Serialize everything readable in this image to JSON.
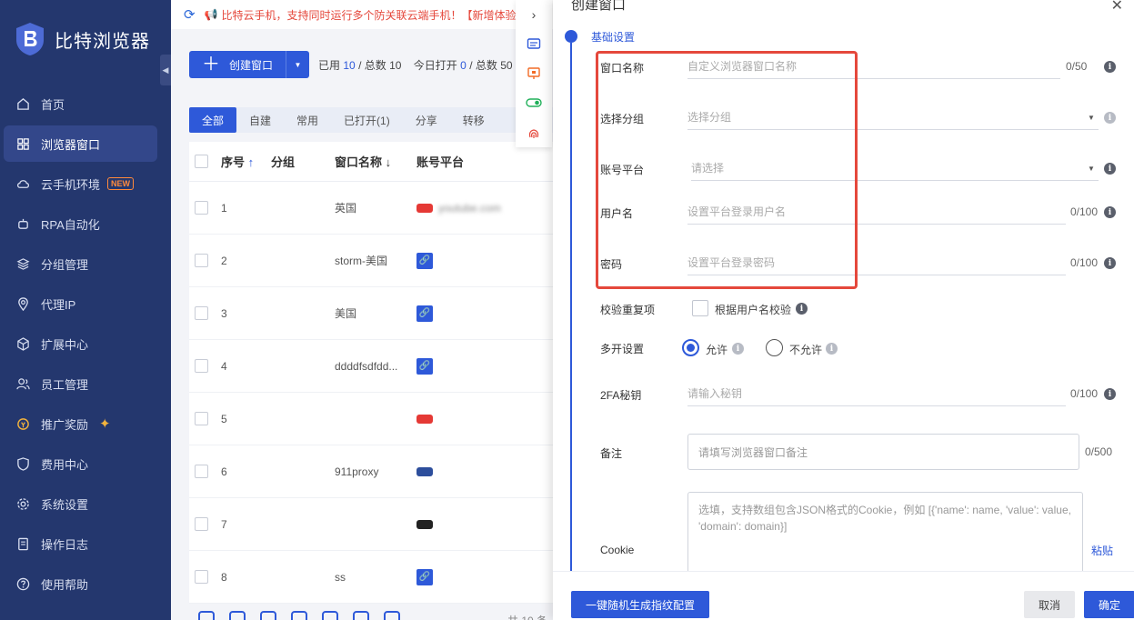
{
  "app": {
    "name": "比特浏览器"
  },
  "sidebar": {
    "items": [
      {
        "label": "首页",
        "icon": "home-icon"
      },
      {
        "label": "浏览器窗口",
        "icon": "grid-icon",
        "active": true
      },
      {
        "label": "云手机环境",
        "icon": "cloud-icon",
        "badge": "NEW"
      },
      {
        "label": "RPA自动化",
        "icon": "robot-icon"
      },
      {
        "label": "分组管理",
        "icon": "layers-icon"
      },
      {
        "label": "代理IP",
        "icon": "location-icon"
      },
      {
        "label": "扩展中心",
        "icon": "cube-icon"
      },
      {
        "label": "员工管理",
        "icon": "users-icon"
      },
      {
        "label": "推广奖励",
        "icon": "coin-icon"
      },
      {
        "label": "费用中心",
        "icon": "shield-icon"
      },
      {
        "label": "系统设置",
        "icon": "gear-icon"
      },
      {
        "label": "操作日志",
        "icon": "log-icon"
      },
      {
        "label": "使用帮助",
        "icon": "help-icon"
      }
    ]
  },
  "notice": {
    "text": "比特云手机，支持同时运行多个防关联云端手机！【新增体验"
  },
  "toolbar": {
    "create_label": "创建窗口",
    "used_prefix": "已用",
    "used": "10",
    "total_prefix": "/ 总数",
    "total": "10",
    "today_prefix": "今日打开",
    "today": "0",
    "today_total_prefix": "/ 总数",
    "today_total": "50"
  },
  "tabs": [
    "全部",
    "自建",
    "常用",
    "已打开(1)",
    "分享",
    "转移"
  ],
  "table": {
    "headers": {
      "seq": "序号",
      "seq_sort": "↑",
      "group": "分组",
      "name": "窗口名称",
      "name_sort": "↓",
      "platform": "账号平台"
    },
    "rows": [
      {
        "seq": "1",
        "group": "",
        "name": "英国",
        "platform": "youtube.com",
        "plat_type": "youtube"
      },
      {
        "seq": "2",
        "group": "",
        "name": "storm-美国",
        "platform": "",
        "plat_type": "link"
      },
      {
        "seq": "3",
        "group": "",
        "name": "美国",
        "platform": "",
        "plat_type": "link"
      },
      {
        "seq": "4",
        "group": "",
        "name": "ddddfsdfdd...",
        "platform": "",
        "plat_type": "link"
      },
      {
        "seq": "5",
        "group": "",
        "name": "",
        "platform": "",
        "plat_type": "youtube"
      },
      {
        "seq": "6",
        "group": "",
        "name": "911proxy",
        "platform": "",
        "plat_type": "facebook"
      },
      {
        "seq": "7",
        "group": "",
        "name": "",
        "platform": "",
        "plat_type": "other"
      },
      {
        "seq": "8",
        "group": "",
        "name": "ss",
        "platform": "",
        "plat_type": "link"
      }
    ],
    "pager_text": "共 10 条"
  },
  "drawer": {
    "title": "创建窗口",
    "step_label": "基础设置",
    "fields": {
      "window_name": {
        "label": "窗口名称",
        "placeholder": "自定义浏览器窗口名称",
        "count": "0/50"
      },
      "group": {
        "label": "选择分组",
        "placeholder": "选择分组"
      },
      "platform": {
        "label": "账号平台",
        "placeholder": "请选择"
      },
      "username": {
        "label": "用户名",
        "placeholder": "设置平台登录用户名",
        "count": "0/100"
      },
      "password": {
        "label": "密码",
        "placeholder": "设置平台登录密码",
        "count": "0/100"
      },
      "dedupe": {
        "label": "校验重复项",
        "option": "根据用户名校验"
      },
      "multi_open": {
        "label": "多开设置",
        "allow": "允许",
        "deny": "不允许"
      },
      "twofa": {
        "label": "2FA秘钥",
        "placeholder": "请输入秘钥",
        "count": "0/100"
      },
      "remark": {
        "label": "备注",
        "placeholder": "请填写浏览器窗口备注",
        "count": "0/500"
      },
      "cookie": {
        "label": "Cookie",
        "placeholder": "选填，支持数组包含JSON格式的Cookie，例如 [{'name': name, 'value': value, 'domain': domain}]",
        "paste": "粘贴"
      }
    },
    "buttons": {
      "generate": "一键随机生成指纹配置",
      "cancel": "取消",
      "confirm": "确定"
    }
  },
  "colors": {
    "primary": "#2e59d9",
    "sidebar": "#24376e",
    "highlight_box": "#e5483c"
  }
}
